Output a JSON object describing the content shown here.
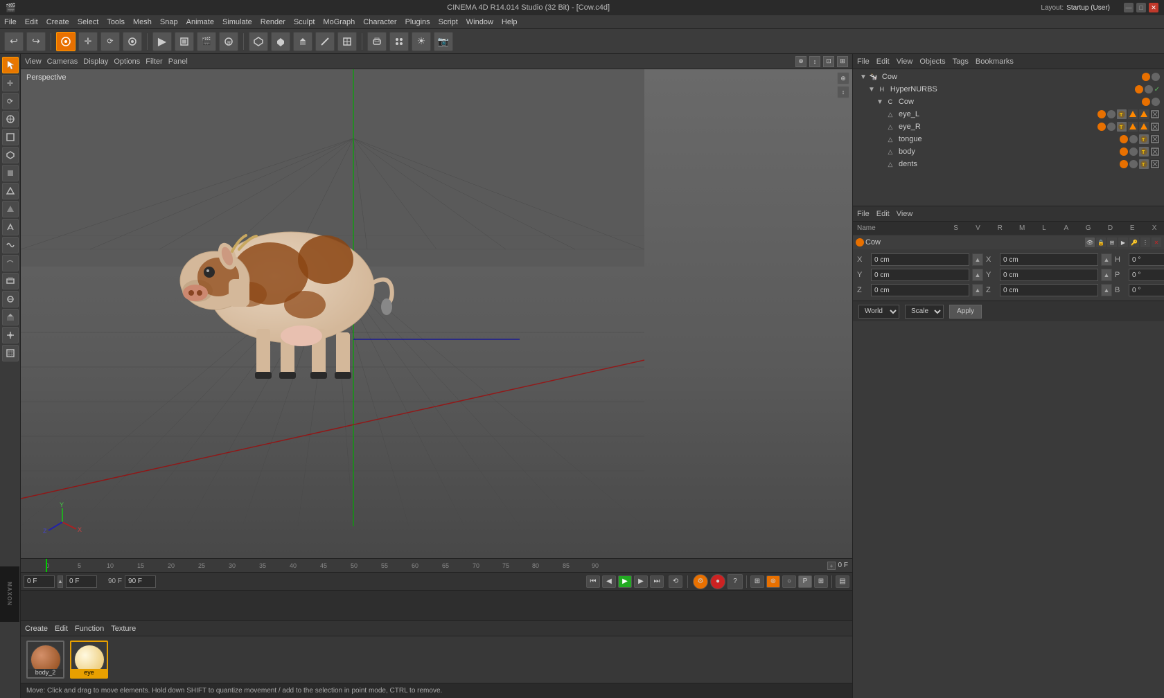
{
  "app": {
    "title": "CINEMA 4D R14.014 Studio (32 Bit) - [Cow.c4d]",
    "layout_label": "Layout:",
    "layout_value": "Startup (User)"
  },
  "title_bar": {
    "minimize": "—",
    "maximize": "□",
    "close": "✕"
  },
  "menu": {
    "items": [
      "File",
      "Edit",
      "Create",
      "Select",
      "Tools",
      "Mesh",
      "Snap",
      "Animate",
      "Simulate",
      "Render",
      "Sculpt",
      "MoGraph",
      "Character",
      "Plugins",
      "Script",
      "Window",
      "Help"
    ]
  },
  "toolbar": {
    "buttons": [
      "↩",
      "↪",
      "⊕",
      "↺",
      "✚",
      "◆",
      "◻",
      "○",
      "◎",
      "➕",
      "✱",
      "⬛",
      "●",
      "⬜",
      "⌗",
      "⬡",
      "⊛",
      "▣",
      "⊞",
      "☰",
      "◈"
    ]
  },
  "viewport": {
    "label": "Perspective",
    "tabs": [
      "View",
      "Cameras",
      "Display",
      "Options",
      "Filter",
      "Panel"
    ]
  },
  "object_manager": {
    "tabs": [
      "File",
      "Edit",
      "View",
      "Objects",
      "Tags",
      "Bookmarks"
    ],
    "objects": [
      {
        "name": "Cow",
        "level": 0,
        "icon": "🐄",
        "type": "scene"
      },
      {
        "name": "HyperNURBS",
        "level": 1,
        "icon": "H",
        "type": "hyper"
      },
      {
        "name": "Cow",
        "level": 2,
        "icon": "C",
        "type": "obj"
      },
      {
        "name": "eye_L",
        "level": 3,
        "icon": "△",
        "type": "mesh"
      },
      {
        "name": "eye_R",
        "level": 3,
        "icon": "△",
        "type": "mesh"
      },
      {
        "name": "tongue",
        "level": 3,
        "icon": "△",
        "type": "mesh"
      },
      {
        "name": "body",
        "level": 3,
        "icon": "△",
        "type": "mesh"
      },
      {
        "name": "dents",
        "level": 3,
        "icon": "△",
        "type": "mesh"
      }
    ]
  },
  "attr_manager": {
    "tabs": [
      "File",
      "Edit",
      "View"
    ],
    "columns": [
      "Name",
      "S",
      "V",
      "R",
      "M",
      "L",
      "A",
      "G",
      "D",
      "E",
      "X"
    ],
    "selected_object": "Cow"
  },
  "coords": {
    "x_label": "X",
    "x_pos": "0 cm",
    "x_size": "0 cm",
    "h_label": "H",
    "h_val": "0 °",
    "y_label": "Y",
    "y_pos": "0 cm",
    "y_size": "0 cm",
    "p_label": "P",
    "p_val": "0 °",
    "z_label": "Z",
    "z_pos": "0 cm",
    "z_size": "0 cm",
    "b_label": "B",
    "b_val": "0 °",
    "world_label": "World",
    "scale_label": "Scale",
    "apply_label": "Apply"
  },
  "timeline": {
    "frame_start": "0 F",
    "frame_end": "90 F",
    "current_frame": "0 F",
    "frame_input": "0 F",
    "frame_max": "90 F",
    "marks": [
      "0",
      "5",
      "10",
      "15",
      "20",
      "25",
      "30",
      "35",
      "40",
      "45",
      "50",
      "55",
      "60",
      "65",
      "70",
      "75",
      "80",
      "85",
      "90"
    ]
  },
  "materials": {
    "menu": [
      "Create",
      "Edit",
      "Function",
      "Texture"
    ],
    "items": [
      {
        "name": "body_2",
        "color": "#8B4513"
      },
      {
        "name": "eye",
        "color": "#e8a000"
      }
    ]
  },
  "status_bar": {
    "text": "Move: Click and drag to move elements. Hold down SHIFT to quantize movement / add to the selection in point mode, CTRL to remove."
  },
  "left_tools": [
    "▷",
    "◉",
    "✛",
    "⟳",
    "📐",
    "▤",
    "◼",
    "🔲",
    "⬡",
    "⌂",
    "△",
    "◇",
    "⌒",
    "∿",
    "⊞",
    "⊙",
    "☰"
  ]
}
